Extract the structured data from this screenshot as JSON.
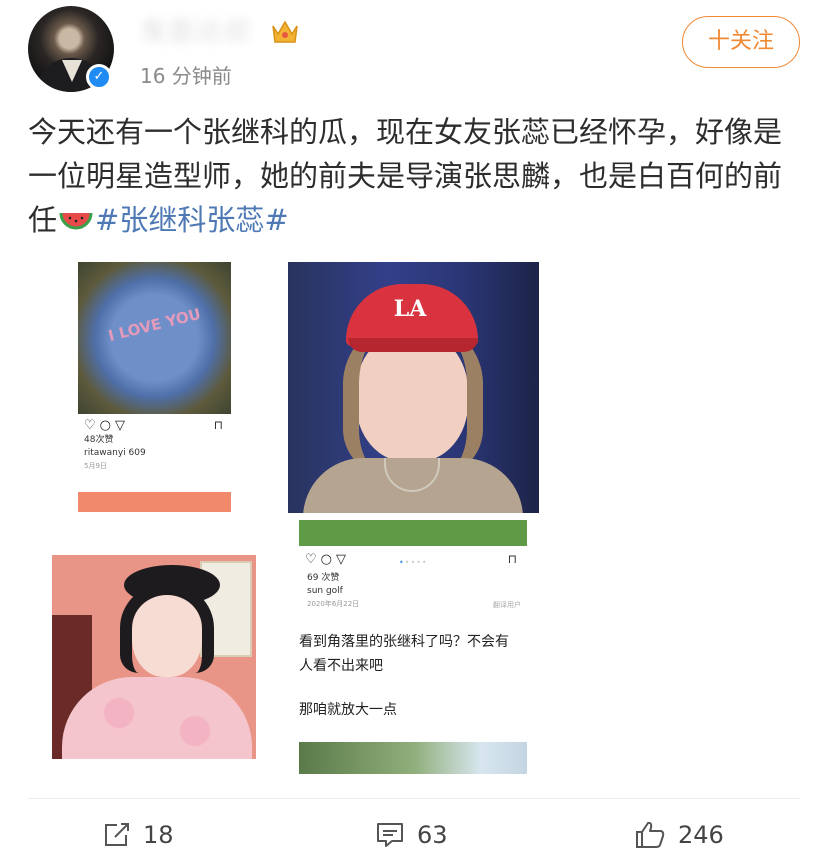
{
  "header": {
    "username": "鬼面达叔",
    "timestamp": "16 分钟前",
    "follow_label": "十关注"
  },
  "post": {
    "text": "今天还有一个张继科的瓜，现在女友张蕊已经怀孕，好像是一位明星造型师，她的前夫是导演张思麟，也是白百何的前任",
    "hashtag": "#张继科张蕊#"
  },
  "images": {
    "img1": {
      "likes": "48次赞",
      "user": "ritawanyi",
      "caption": "609",
      "date": "5月9日",
      "flower_text": "I LOVE YOU"
    },
    "img2": {
      "cap_logo": "LA"
    },
    "img4": {
      "likes": "69 次赞",
      "user": "sun golf",
      "date": "2020年6月22日",
      "right_note": "翻译用户",
      "text1": "看到角落里的张继科了吗？不会有人看不出来吧",
      "text2": "那咱就放大一点"
    }
  },
  "actions": {
    "repost_count": "18",
    "comment_count": "63",
    "like_count": "246"
  },
  "colors": {
    "accent": "#f08a35",
    "link": "#4f79b5",
    "verified": "#1f8bf3"
  }
}
